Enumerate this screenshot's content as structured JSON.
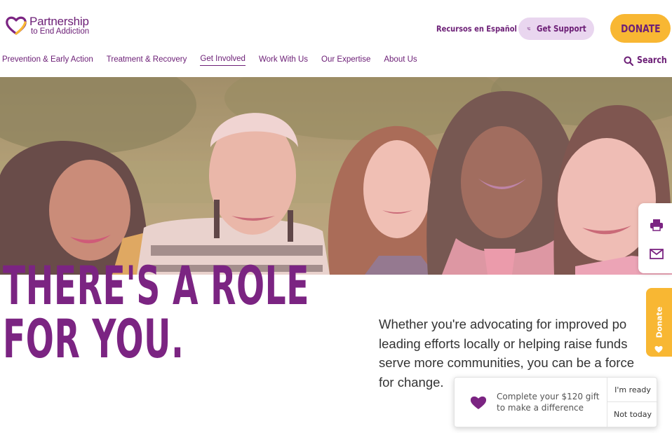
{
  "brand": {
    "line1": "Partnership",
    "line2": "to End Addiction",
    "purple": "#6d2077",
    "gold": "#f8b733"
  },
  "header": {
    "spanish_link": "Recursos en Español",
    "support_label": "Get Support",
    "support_icon": "phone-heart-icon",
    "donate_label": "DONATE"
  },
  "nav": {
    "items": [
      {
        "label": "Prevention & Early Action"
      },
      {
        "label": "Treatment & Recovery"
      },
      {
        "label": "Get Involved",
        "active": true
      },
      {
        "label": "Work With Us"
      },
      {
        "label": "Our Expertise"
      },
      {
        "label": "About Us"
      }
    ],
    "search_label": "Search"
  },
  "hero": {
    "headline_line1": "THERE'S A ROLE",
    "headline_line2": "FOR YOU.",
    "body_lines": [
      "Whether you're advocating for improved po",
      "leading efforts locally or helping raise funds",
      "serve more communities, you can be a force",
      "for change."
    ]
  },
  "side_tools": {
    "icons": [
      "print-icon",
      "mail-icon"
    ]
  },
  "donate_tab": {
    "label": "Donate"
  },
  "gift_popup": {
    "message": "Complete your $120 gift to make a difference",
    "ready_label": "I'm ready",
    "later_label": "Not today"
  }
}
